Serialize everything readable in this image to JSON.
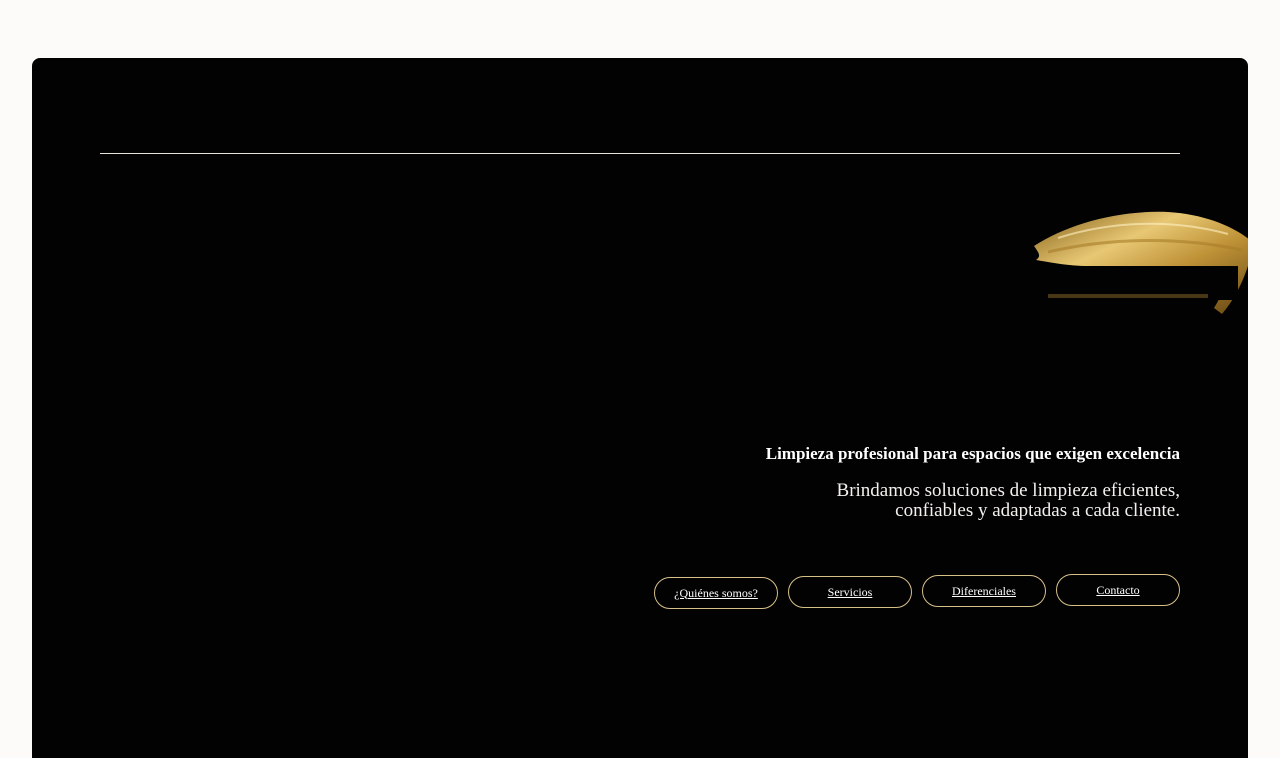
{
  "hero": {
    "headline": "Limpieza profesional para espacios que exigen excelencia",
    "subline_1": "Brindamos soluciones de limpieza eficientes,",
    "subline_2": "confiables y adaptadas a cada cliente."
  },
  "nav": {
    "items": [
      {
        "label": "¿Quiénes somos?"
      },
      {
        "label": "Servicios"
      },
      {
        "label": "Diferenciales"
      },
      {
        "label": "Contacto"
      }
    ]
  },
  "colors": {
    "page_background": "#fcfbf9",
    "card_background": "#020203",
    "accent_gold": "#d8c08a",
    "text": "#ffffff"
  },
  "decor": {
    "brush_stroke": "gold-brush-stroke"
  }
}
